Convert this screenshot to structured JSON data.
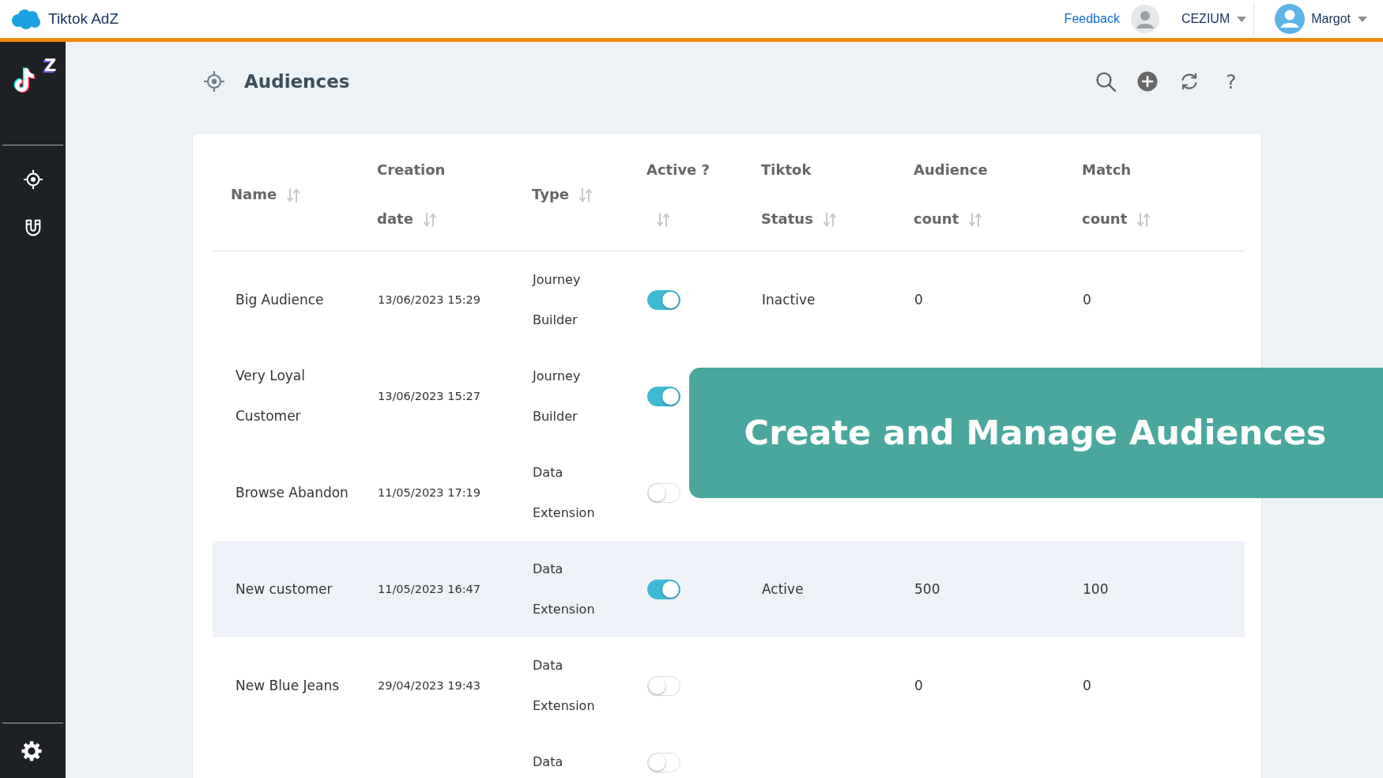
{
  "app_bar": {
    "title": "Tiktok AdZ",
    "feedback": "Feedback",
    "org": "CEZIUM",
    "user": "Margot"
  },
  "sidebar": {
    "logo_text": "Z"
  },
  "page_header": {
    "title": "Audiences",
    "help": "?"
  },
  "table": {
    "columns": [
      {
        "label": "Name",
        "sortable": true
      },
      {
        "label": "Creation date",
        "sortable": true
      },
      {
        "label": "Type",
        "sortable": true
      },
      {
        "label": "Active ?",
        "sortable": true
      },
      {
        "label": "Tiktok Status",
        "sortable": true
      },
      {
        "label": "Audience count",
        "sortable": true
      },
      {
        "label": "Match count",
        "sortable": true
      }
    ],
    "rows": [
      {
        "name": "Big Audience",
        "creation_date": "13/06/2023 15:29",
        "type": "Journey Builder",
        "active": true,
        "tiktok_status": "Inactive",
        "audience_count": "0",
        "match_count": "0",
        "highlighted": false
      },
      {
        "name": "Very Loyal Customer",
        "creation_date": "13/06/2023 15:27",
        "type": "Journey Builder",
        "active": true,
        "highlighted": false
      },
      {
        "name": "Browse Abandon",
        "creation_date": "11/05/2023 17:19",
        "type": "Data Extension",
        "active": false,
        "highlighted": false
      },
      {
        "name": "New customer",
        "creation_date": "11/05/2023 16:47",
        "type": "Data Extension",
        "active": true,
        "tiktok_status": "Active",
        "audience_count": "500",
        "match_count": "100",
        "highlighted": true
      },
      {
        "name": "New Blue Jeans",
        "creation_date": "29/04/2023 19:43",
        "type": "Data Extension",
        "active": false,
        "audience_count": "0",
        "match_count": "0",
        "highlighted": false
      },
      {
        "type": "Data",
        "active": false,
        "highlighted": false
      }
    ]
  },
  "banner": {
    "text": "Create and Manage Audiences"
  }
}
